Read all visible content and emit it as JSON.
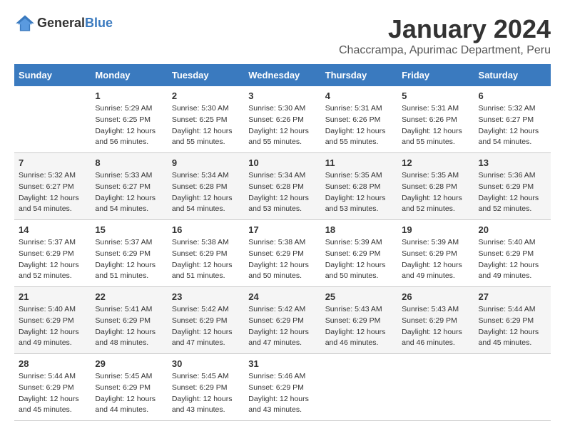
{
  "header": {
    "logo_general": "General",
    "logo_blue": "Blue",
    "month": "January 2024",
    "location": "Chaccrampa, Apurimac Department, Peru"
  },
  "days_of_week": [
    "Sunday",
    "Monday",
    "Tuesday",
    "Wednesday",
    "Thursday",
    "Friday",
    "Saturday"
  ],
  "weeks": [
    [
      {
        "day": "",
        "sunrise": "",
        "sunset": "",
        "daylight": ""
      },
      {
        "day": "1",
        "sunrise": "5:29 AM",
        "sunset": "6:25 PM",
        "daylight": "12 hours and 56 minutes."
      },
      {
        "day": "2",
        "sunrise": "5:30 AM",
        "sunset": "6:25 PM",
        "daylight": "12 hours and 55 minutes."
      },
      {
        "day": "3",
        "sunrise": "5:30 AM",
        "sunset": "6:26 PM",
        "daylight": "12 hours and 55 minutes."
      },
      {
        "day": "4",
        "sunrise": "5:31 AM",
        "sunset": "6:26 PM",
        "daylight": "12 hours and 55 minutes."
      },
      {
        "day": "5",
        "sunrise": "5:31 AM",
        "sunset": "6:26 PM",
        "daylight": "12 hours and 55 minutes."
      },
      {
        "day": "6",
        "sunrise": "5:32 AM",
        "sunset": "6:27 PM",
        "daylight": "12 hours and 54 minutes."
      }
    ],
    [
      {
        "day": "7",
        "sunrise": "5:32 AM",
        "sunset": "6:27 PM",
        "daylight": "12 hours and 54 minutes."
      },
      {
        "day": "8",
        "sunrise": "5:33 AM",
        "sunset": "6:27 PM",
        "daylight": "12 hours and 54 minutes."
      },
      {
        "day": "9",
        "sunrise": "5:34 AM",
        "sunset": "6:28 PM",
        "daylight": "12 hours and 54 minutes."
      },
      {
        "day": "10",
        "sunrise": "5:34 AM",
        "sunset": "6:28 PM",
        "daylight": "12 hours and 53 minutes."
      },
      {
        "day": "11",
        "sunrise": "5:35 AM",
        "sunset": "6:28 PM",
        "daylight": "12 hours and 53 minutes."
      },
      {
        "day": "12",
        "sunrise": "5:35 AM",
        "sunset": "6:28 PM",
        "daylight": "12 hours and 52 minutes."
      },
      {
        "day": "13",
        "sunrise": "5:36 AM",
        "sunset": "6:29 PM",
        "daylight": "12 hours and 52 minutes."
      }
    ],
    [
      {
        "day": "14",
        "sunrise": "5:37 AM",
        "sunset": "6:29 PM",
        "daylight": "12 hours and 52 minutes."
      },
      {
        "day": "15",
        "sunrise": "5:37 AM",
        "sunset": "6:29 PM",
        "daylight": "12 hours and 51 minutes."
      },
      {
        "day": "16",
        "sunrise": "5:38 AM",
        "sunset": "6:29 PM",
        "daylight": "12 hours and 51 minutes."
      },
      {
        "day": "17",
        "sunrise": "5:38 AM",
        "sunset": "6:29 PM",
        "daylight": "12 hours and 50 minutes."
      },
      {
        "day": "18",
        "sunrise": "5:39 AM",
        "sunset": "6:29 PM",
        "daylight": "12 hours and 50 minutes."
      },
      {
        "day": "19",
        "sunrise": "5:39 AM",
        "sunset": "6:29 PM",
        "daylight": "12 hours and 49 minutes."
      },
      {
        "day": "20",
        "sunrise": "5:40 AM",
        "sunset": "6:29 PM",
        "daylight": "12 hours and 49 minutes."
      }
    ],
    [
      {
        "day": "21",
        "sunrise": "5:40 AM",
        "sunset": "6:29 PM",
        "daylight": "12 hours and 49 minutes."
      },
      {
        "day": "22",
        "sunrise": "5:41 AM",
        "sunset": "6:29 PM",
        "daylight": "12 hours and 48 minutes."
      },
      {
        "day": "23",
        "sunrise": "5:42 AM",
        "sunset": "6:29 PM",
        "daylight": "12 hours and 47 minutes."
      },
      {
        "day": "24",
        "sunrise": "5:42 AM",
        "sunset": "6:29 PM",
        "daylight": "12 hours and 47 minutes."
      },
      {
        "day": "25",
        "sunrise": "5:43 AM",
        "sunset": "6:29 PM",
        "daylight": "12 hours and 46 minutes."
      },
      {
        "day": "26",
        "sunrise": "5:43 AM",
        "sunset": "6:29 PM",
        "daylight": "12 hours and 46 minutes."
      },
      {
        "day": "27",
        "sunrise": "5:44 AM",
        "sunset": "6:29 PM",
        "daylight": "12 hours and 45 minutes."
      }
    ],
    [
      {
        "day": "28",
        "sunrise": "5:44 AM",
        "sunset": "6:29 PM",
        "daylight": "12 hours and 45 minutes."
      },
      {
        "day": "29",
        "sunrise": "5:45 AM",
        "sunset": "6:29 PM",
        "daylight": "12 hours and 44 minutes."
      },
      {
        "day": "30",
        "sunrise": "5:45 AM",
        "sunset": "6:29 PM",
        "daylight": "12 hours and 43 minutes."
      },
      {
        "day": "31",
        "sunrise": "5:46 AM",
        "sunset": "6:29 PM",
        "daylight": "12 hours and 43 minutes."
      },
      {
        "day": "",
        "sunrise": "",
        "sunset": "",
        "daylight": ""
      },
      {
        "day": "",
        "sunrise": "",
        "sunset": "",
        "daylight": ""
      },
      {
        "day": "",
        "sunrise": "",
        "sunset": "",
        "daylight": ""
      }
    ]
  ]
}
